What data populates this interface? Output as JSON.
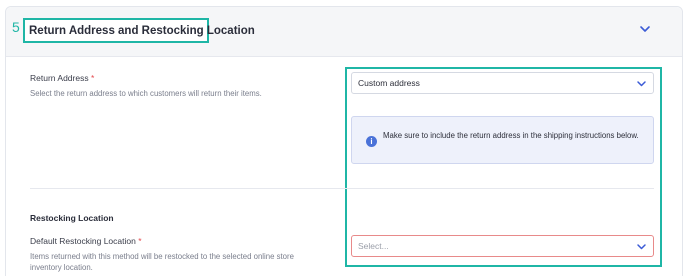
{
  "section": {
    "step_number": "5",
    "title": "Return Address and Restocking Location"
  },
  "return_address": {
    "label": "Return Address",
    "required_mark": "*",
    "help": "Select the return address to which customers will return their items.",
    "selected_value": "Custom address"
  },
  "info_banner": {
    "text": "Make sure to include the return address in the shipping instructions below."
  },
  "restocking": {
    "heading": "Restocking Location",
    "label": "Default Restocking Location",
    "required_mark": "*",
    "help": "Items returned with this method will be restocked to the selected online store inventory location.",
    "placeholder": "Select..."
  },
  "colors": {
    "highlight": "#1fb6a6",
    "info_icon": "#4a72d8",
    "required": "#e5484d",
    "error_border": "#e88a8a"
  },
  "icons": {
    "collapse": "chevron-down-icon",
    "select_arrow": "chevron-down-icon",
    "info": "info-icon"
  }
}
